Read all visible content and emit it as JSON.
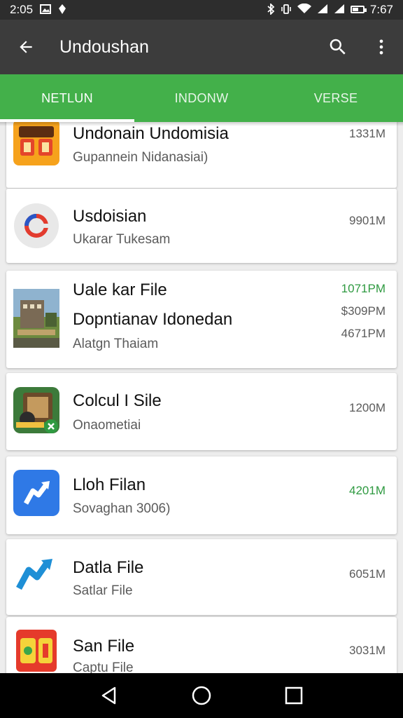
{
  "status_bar": {
    "time_left": "2:05",
    "time_right": "7:67",
    "battery_level": 0.55
  },
  "app_bar": {
    "title": "Undoushan",
    "icons": [
      "arrow-back-icon",
      "search-icon",
      "more-vert-icon"
    ]
  },
  "tabs": [
    {
      "label": "NETLUN",
      "active": true
    },
    {
      "label": "INDONW",
      "active": false
    },
    {
      "label": "VERSE",
      "active": false
    }
  ],
  "items": [
    {
      "title": "Undonain Undomisia",
      "subtitle": "Gupannein Nidanasiai)",
      "sizes": [
        "1331M"
      ],
      "icon": "app-icon-orange-qb"
    },
    {
      "title": "Usdoisian",
      "subtitle": "Ukarar Tukesam",
      "sizes": [
        "9901M"
      ],
      "icon": "app-icon-red-circle"
    },
    {
      "title": "Uale kar File",
      "title2": "Dopntianav Idonedan",
      "subtitle": "Alatgn Thaiam",
      "sizes": [
        "1071PM",
        "$309PM",
        "4671PM"
      ],
      "icon": "app-icon-photo-street"
    },
    {
      "title": "Colcul I Sile",
      "subtitle": "Onaometiai",
      "sizes": [
        "1200M"
      ],
      "icon": "app-icon-game"
    },
    {
      "title": "Lloh Filan",
      "subtitle": "Sovaghan 3006)",
      "sizes": [
        "4201M"
      ],
      "icon": "app-icon-blue-share"
    },
    {
      "title": "Datla File",
      "subtitle": "Satlar File",
      "sizes": [
        "6051M"
      ],
      "icon": "app-icon-blue-arrow"
    },
    {
      "title": "San File",
      "subtitle": "Captu File",
      "sizes": [
        "3031M"
      ],
      "icon": "app-icon-red-yellow"
    }
  ],
  "nav_bar": {
    "icons": [
      "nav-back-icon",
      "nav-home-icon",
      "nav-recents-icon"
    ]
  },
  "colors": {
    "status_bar": "#2d2d2d",
    "app_bar": "#3c3c3c",
    "tab_bar": "#43b04a",
    "size_green": "#2f9a41"
  }
}
